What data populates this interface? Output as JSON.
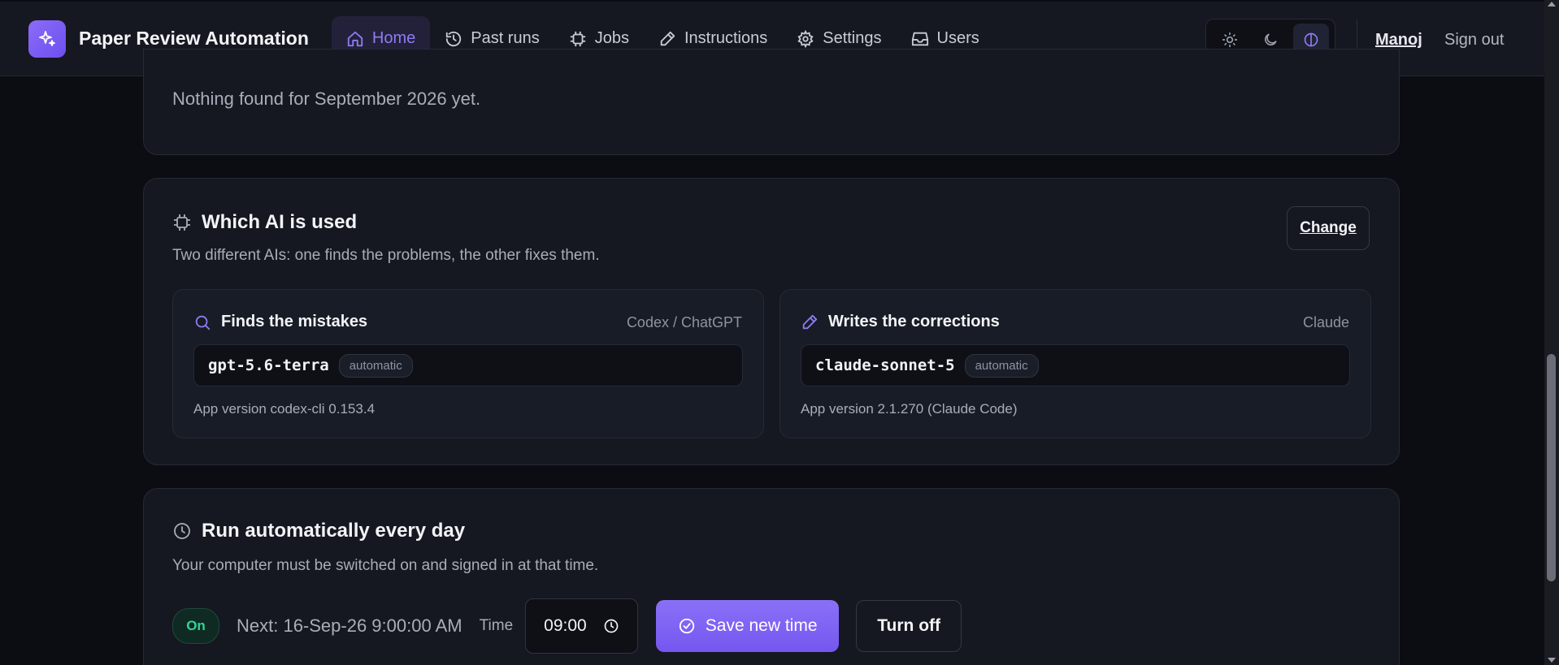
{
  "app": {
    "title": "Paper Review Automation"
  },
  "nav": {
    "items": [
      {
        "label": "Home",
        "icon": "home-icon",
        "active": true
      },
      {
        "label": "Past runs",
        "icon": "history-icon"
      },
      {
        "label": "Jobs",
        "icon": "chip-icon"
      },
      {
        "label": "Instructions",
        "icon": "pen-icon"
      },
      {
        "label": "Settings",
        "icon": "gear-icon"
      },
      {
        "label": "Users",
        "icon": "inbox-icon"
      }
    ]
  },
  "header": {
    "user": "Manoj",
    "signout": "Sign out"
  },
  "empty": {
    "text": "Nothing found for September 2026 yet."
  },
  "ai": {
    "title": "Which AI is used",
    "subtitle": "Two different AIs: one finds the problems, the other fixes them.",
    "change": "Change",
    "finder": {
      "title": "Finds the mistakes",
      "provider": "Codex / ChatGPT",
      "model": "gpt-5.6-terra",
      "badge": "automatic",
      "version": "App version codex-cli 0.153.4"
    },
    "writer": {
      "title": "Writes the corrections",
      "provider": "Claude",
      "model": "claude-sonnet-5",
      "badge": "automatic",
      "version": "App version 2.1.270 (Claude Code)"
    }
  },
  "schedule": {
    "title": "Run automatically every day",
    "subtitle": "Your computer must be switched on and signed in at that time.",
    "status": "On",
    "next": "Next: 16-Sep-26 9:00:00 AM",
    "time_label": "Time",
    "time_value": "09:00",
    "save": "Save new time",
    "turn_off": "Turn off"
  },
  "colors": {
    "accent": "#8b6cf7",
    "background": "#0b0d12",
    "card": "#151820",
    "success": "#34d399"
  }
}
